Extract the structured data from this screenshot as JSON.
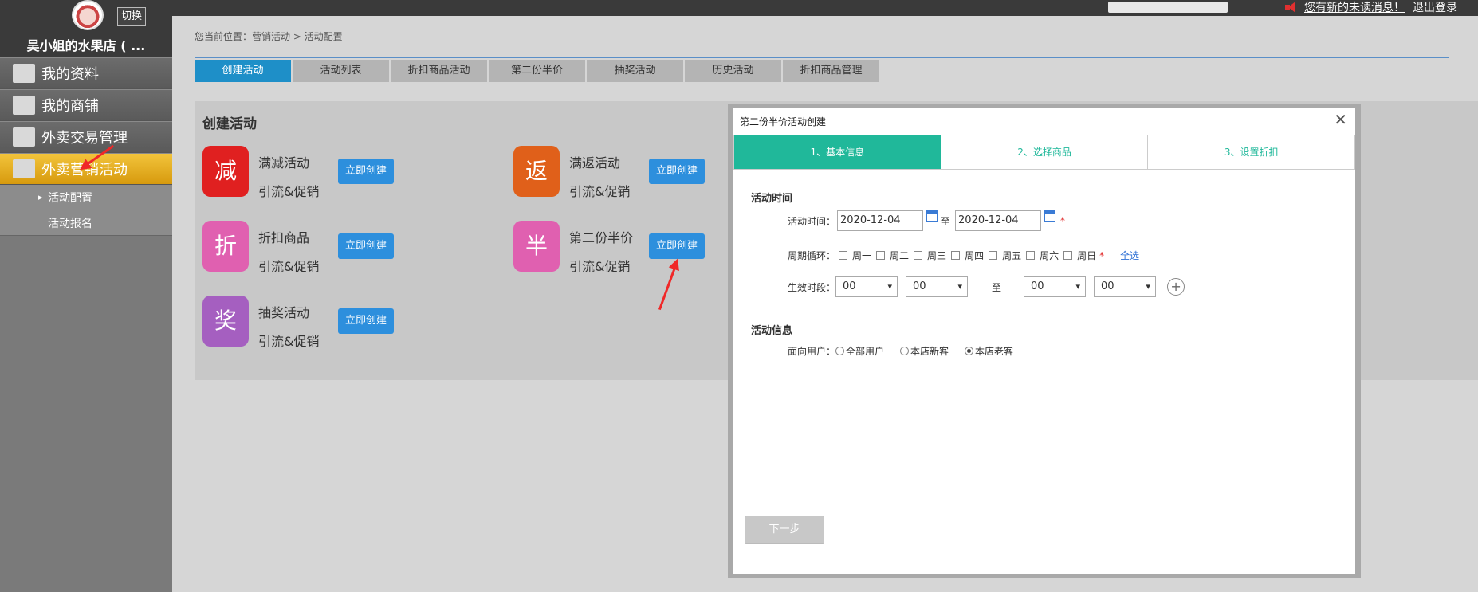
{
  "topbar": {
    "message_link": "您有新的未读消息！",
    "logout": "退出登录"
  },
  "sidebar": {
    "store_name": "吴小姐的水果店 ( ...",
    "switch": "切换",
    "items": [
      {
        "label": "我的资料",
        "icon": "profile-card-icon"
      },
      {
        "label": "我的商铺",
        "icon": "home-icon"
      },
      {
        "label": "外卖交易管理",
        "icon": "calendar-icon"
      },
      {
        "label": "外卖营销活动",
        "icon": "gift-icon"
      }
    ],
    "subitems": [
      {
        "label": "活动配置"
      },
      {
        "label": "活动报名"
      }
    ]
  },
  "main": {
    "breadcrumb": "您当前位置：营销活动 > 活动配置",
    "tabs": [
      "创建活动",
      "活动列表",
      "折扣商品活动",
      "第二份半价",
      "抽奖活动",
      "历史活动",
      "折扣商品管理"
    ],
    "panel_title": "创建活动",
    "activities": [
      {
        "badge": "减",
        "name": "满减活动",
        "sub": "引流&促销",
        "btn": "立即创建",
        "color": "#e02020"
      },
      {
        "badge": "返",
        "name": "满返活动",
        "sub": "引流&促销",
        "btn": "立即创建",
        "color": "#e0601a"
      },
      {
        "badge": "折",
        "name": "折扣商品",
        "sub": "引流&促销",
        "btn": "立即创建",
        "color": "#e060b0"
      },
      {
        "badge": "半",
        "name": "第二份半价",
        "sub": "引流&促销",
        "btn": "立即创建",
        "color": "#e060b0"
      },
      {
        "badge": "奖",
        "name": "抽奖活动",
        "sub": "引流&促销",
        "btn": "立即创建",
        "color": "#a55fc0"
      }
    ]
  },
  "modal": {
    "title": "第二份半价活动创建",
    "close": "✕",
    "steps": [
      "1、基本信息",
      "2、选择商品",
      "3、设置折扣"
    ],
    "section_time": "活动时间",
    "time_label": "活动时间：",
    "start_date": "2020-12-04",
    "to": "至",
    "end_date": "2020-12-04",
    "req": "*",
    "cycle_label": "周期循环：",
    "days": [
      "周一",
      "周二",
      "周三",
      "周四",
      "周五",
      "周六",
      "周日"
    ],
    "select_all": "全选",
    "period_label": "生效时段：",
    "h1": "00",
    "m1": "00",
    "to2": "至",
    "h2": "00",
    "m2": "00",
    "plus": "+",
    "section_info": "活动信息",
    "audience_label": "面向用户：",
    "audience": [
      "全部用户",
      "本店新客",
      "本店老客"
    ],
    "audience_selected": "本店老客",
    "next": "下一步"
  }
}
